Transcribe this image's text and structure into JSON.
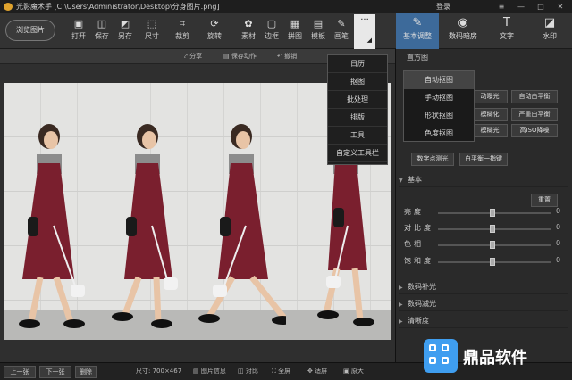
{
  "titlebar": {
    "title": "光影魔术手 [C:\\Users\\Administrator\\Desktop\\分身图片.png]",
    "login": "登录",
    "controls": [
      "≡",
      "—",
      "□",
      "✕"
    ]
  },
  "toolbar": {
    "browse": "浏览图片",
    "tools": [
      {
        "label": "打开",
        "icon": "open-icon",
        "glyph": "▣"
      },
      {
        "label": "保存",
        "icon": "save-icon",
        "glyph": "◫"
      },
      {
        "label": "另存",
        "icon": "save-as-icon",
        "glyph": "◩"
      },
      {
        "label": "尺寸",
        "icon": "resize-icon",
        "glyph": "⬚"
      },
      {
        "label": "裁剪",
        "icon": "crop-icon",
        "glyph": "⌗"
      },
      {
        "label": "旋转",
        "icon": "rotate-icon",
        "glyph": "⟳"
      },
      {
        "label": "素材",
        "icon": "material-icon",
        "glyph": "✿"
      },
      {
        "label": "边框",
        "icon": "border-icon",
        "glyph": "▢"
      },
      {
        "label": "拼图",
        "icon": "collage-icon",
        "glyph": "▦"
      },
      {
        "label": "模板",
        "icon": "template-icon",
        "glyph": "▤"
      },
      {
        "label": "画笔",
        "icon": "brush-icon",
        "glyph": "✎"
      }
    ],
    "more": "···"
  },
  "right_tabs": [
    {
      "label": "基本调整",
      "glyph": "✎",
      "icon": "adjust-icon"
    },
    {
      "label": "数码暗房",
      "glyph": "◉",
      "icon": "darkroom-icon"
    },
    {
      "label": "文字",
      "glyph": "T",
      "icon": "text-icon"
    },
    {
      "label": "水印",
      "glyph": "◪",
      "icon": "watermark-icon"
    }
  ],
  "subbar": {
    "share": "分享",
    "save_action": "保存动作",
    "undo": "撤销"
  },
  "more_menu": [
    "日历",
    "抠图",
    "批处理",
    "排版",
    "工具",
    "自定义工具栏"
  ],
  "submenu": [
    "自动抠图",
    "手动抠图",
    "形状抠图",
    "色度抠图"
  ],
  "panel": {
    "title": "直方图",
    "buttons_row1": [
      "自动曝光",
      "自动白平衡"
    ],
    "buttons_row2": [
      "严重白平衡"
    ],
    "buttons_row3": [
      "高ISO降噪"
    ],
    "partial_buttons": [
      "动曝光",
      "模糊化",
      "模糊光"
    ],
    "buttons_row4": [
      "数字点测光",
      "白平衡一指键"
    ],
    "basic": "基本",
    "reset": "重置",
    "sliders": [
      {
        "label": "亮度",
        "value": "0",
        "pos": 0.5
      },
      {
        "label": "对比度",
        "value": "0",
        "pos": 0.5
      },
      {
        "label": "色相",
        "value": "0",
        "pos": 0.5
      },
      {
        "label": "饱和度",
        "value": "0",
        "pos": 0.5
      }
    ],
    "sections": [
      "数码补光",
      "数码减光",
      "清晰度"
    ]
  },
  "bottombar": {
    "prev": "上一张",
    "next": "下一张",
    "delete": "删除",
    "size": "尺寸: 700×467",
    "info": "图片信息",
    "compare": "对比",
    "fullscreen": "全屏",
    "fit": "适屏",
    "original": "原大"
  },
  "watermark": "鼎品软件"
}
